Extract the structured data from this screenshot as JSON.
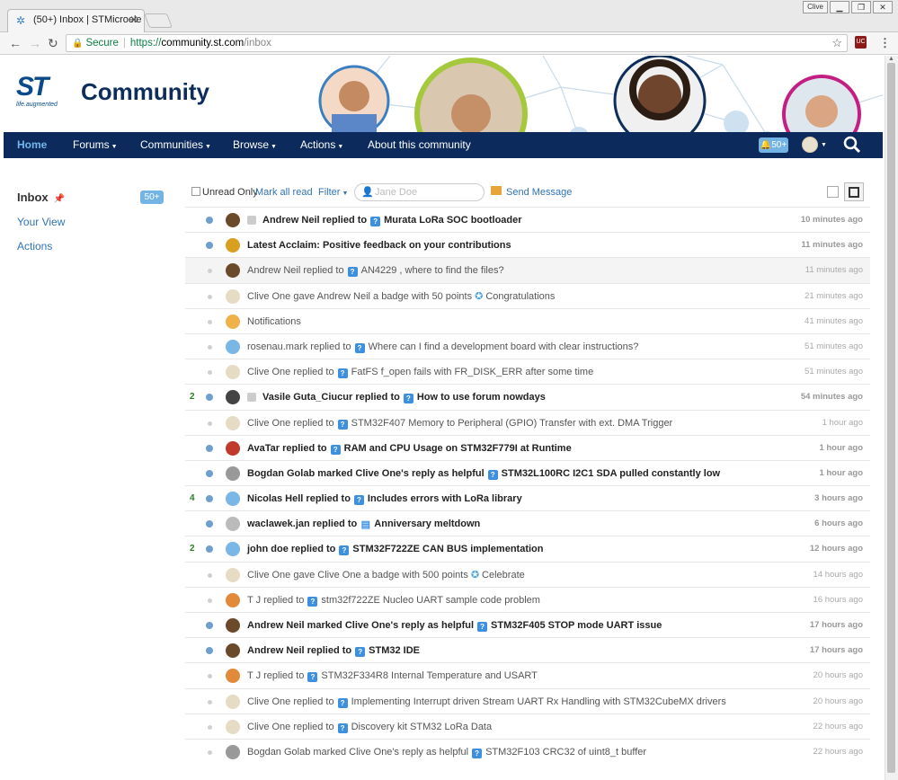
{
  "browser": {
    "tab_title": "(50+) Inbox | STMicroele",
    "close_glyph": "✕",
    "user_label": "Clive",
    "secure_label": "Secure",
    "url_protocol": "https://",
    "url_host": "community.st.com",
    "url_path": "/inbox",
    "extension_badge": "UC"
  },
  "header": {
    "logo_mark": "ST",
    "logo_tagline": "life.augmented",
    "title": "Community"
  },
  "nav": {
    "items": [
      {
        "label": "Home",
        "active": true
      },
      {
        "label": "Forums"
      },
      {
        "label": "Communities"
      },
      {
        "label": "Browse"
      },
      {
        "label": "Actions"
      },
      {
        "label": "About this community"
      }
    ],
    "notifications_badge": "50+"
  },
  "sidebar": {
    "inbox_label": "Inbox",
    "inbox_count": "50+",
    "links": [
      "Your View",
      "Actions"
    ]
  },
  "toolbar": {
    "unread_only": "Unread Only",
    "mark_all_read": "Mark all read",
    "filter": "Filter",
    "search_placeholder": "Jane Doe",
    "send_message": "Send Message"
  },
  "messages": [
    {
      "count": "",
      "unread": true,
      "avatar": "#6b4a2b",
      "icon": "ext",
      "actor": "Andrew Neil replied to",
      "kind": "q",
      "subject": "Murata LoRa SOC bootloader",
      "time": "10 minutes ago"
    },
    {
      "count": "",
      "unread": true,
      "avatar": "#d9a020",
      "icon": "",
      "actor": "Latest Acclaim: Positive feedback on your contributions",
      "kind": "",
      "subject": "",
      "time": "11 minutes ago"
    },
    {
      "count": "",
      "unread": false,
      "avatar": "#6b4a2b",
      "icon": "",
      "actor": "Andrew Neil replied to",
      "kind": "q",
      "subject": "AN4229 , where to find the files?",
      "time": "11 minutes ago",
      "hl": true
    },
    {
      "count": "",
      "unread": false,
      "avatar": "#e6dcc5",
      "icon": "",
      "actor": "Clive One gave Andrew Neil a badge with 50 points",
      "kind": "badge",
      "subject": "Congratulations",
      "time": "21 minutes ago"
    },
    {
      "count": "",
      "unread": false,
      "avatar": "#f0b04a",
      "icon": "",
      "actor": "Notifications",
      "kind": "",
      "subject": "",
      "time": "41 minutes ago"
    },
    {
      "count": "",
      "unread": false,
      "avatar": "#7ab6e6",
      "icon": "",
      "actor": "rosenau.mark replied to",
      "kind": "q",
      "subject": "Where can I find a development board with clear instructions?",
      "time": "51 minutes ago"
    },
    {
      "count": "",
      "unread": false,
      "avatar": "#e6dcc5",
      "icon": "",
      "actor": "Clive One replied to",
      "kind": "q",
      "subject": "FatFS f_open fails with FR_DISK_ERR after some time",
      "time": "51 minutes ago"
    },
    {
      "count": "2",
      "unread": true,
      "avatar": "#444",
      "icon": "ext",
      "actor": "Vasile Guta_Ciucur replied to",
      "kind": "q",
      "subject": "How to use forum nowdays",
      "time": "54 minutes ago"
    },
    {
      "count": "",
      "unread": false,
      "avatar": "#e6dcc5",
      "icon": "",
      "actor": "Clive One replied to",
      "kind": "q",
      "subject": "STM32F407 Memory to Peripheral (GPIO) Transfer with ext. DMA Trigger",
      "time": "1 hour ago"
    },
    {
      "count": "",
      "unread": true,
      "avatar": "#c0392b",
      "icon": "",
      "actor": "AvaTar replied to",
      "kind": "q",
      "subject": "RAM and CPU Usage on STM32F779I at Runtime",
      "time": "1 hour ago"
    },
    {
      "count": "",
      "unread": true,
      "avatar": "#999",
      "icon": "",
      "actor": "Bogdan Golab marked Clive One's reply as helpful",
      "kind": "q",
      "subject": "STM32L100RC I2C1 SDA pulled constantly low",
      "time": "1 hour ago"
    },
    {
      "count": "4",
      "unread": true,
      "avatar": "#7ab6e6",
      "icon": "",
      "actor": "Nicolas Hell replied to",
      "kind": "q",
      "subject": "Includes errors with LoRa library",
      "time": "3 hours ago"
    },
    {
      "count": "",
      "unread": true,
      "avatar": "#bbb",
      "icon": "",
      "actor": "waclawek.jan replied to",
      "kind": "msg",
      "subject": "Anniversary meltdown",
      "time": "6 hours ago"
    },
    {
      "count": "2",
      "unread": true,
      "avatar": "#7ab6e6",
      "icon": "",
      "actor": "john doe replied to",
      "kind": "q",
      "subject": "STM32F722ZE CAN BUS implementation",
      "time": "12 hours ago"
    },
    {
      "count": "",
      "unread": false,
      "avatar": "#e6dcc5",
      "icon": "",
      "actor": "Clive One gave Clive One a badge with 500 points",
      "kind": "badge",
      "subject": "Celebrate",
      "time": "14 hours ago"
    },
    {
      "count": "",
      "unread": false,
      "avatar": "#e08a3a",
      "icon": "",
      "actor": "T J replied to",
      "kind": "q",
      "subject": "stm32f722ZE Nucleo  UART sample code problem",
      "time": "16 hours ago"
    },
    {
      "count": "",
      "unread": true,
      "avatar": "#6b4a2b",
      "icon": "",
      "actor": "Andrew Neil marked Clive One's reply as helpful",
      "kind": "q",
      "subject": "STM32F405 STOP mode UART issue",
      "time": "17 hours ago"
    },
    {
      "count": "",
      "unread": true,
      "avatar": "#6b4a2b",
      "icon": "",
      "actor": "Andrew Neil replied to",
      "kind": "q",
      "subject": "STM32 IDE",
      "time": "17 hours ago"
    },
    {
      "count": "",
      "unread": false,
      "avatar": "#e08a3a",
      "icon": "",
      "actor": "T J replied to",
      "kind": "q",
      "subject": "STM32F334R8 Internal Temperature and USART",
      "time": "20 hours ago"
    },
    {
      "count": "",
      "unread": false,
      "avatar": "#e6dcc5",
      "icon": "",
      "actor": "Clive One replied to",
      "kind": "q",
      "subject": "Implementing Interrupt driven Stream UART Rx Handling with STM32CubeMX drivers",
      "time": "20 hours ago"
    },
    {
      "count": "",
      "unread": false,
      "avatar": "#e6dcc5",
      "icon": "",
      "actor": "Clive One replied to",
      "kind": "q",
      "subject": "Discovery kit STM32 LoRa Data",
      "time": "22 hours ago"
    },
    {
      "count": "",
      "unread": false,
      "avatar": "#999",
      "icon": "",
      "actor": "Bogdan Golab marked Clive One's reply as helpful",
      "kind": "q",
      "subject": "STM32F103 CRC32 of uint8_t buffer",
      "time": "22 hours ago"
    }
  ]
}
